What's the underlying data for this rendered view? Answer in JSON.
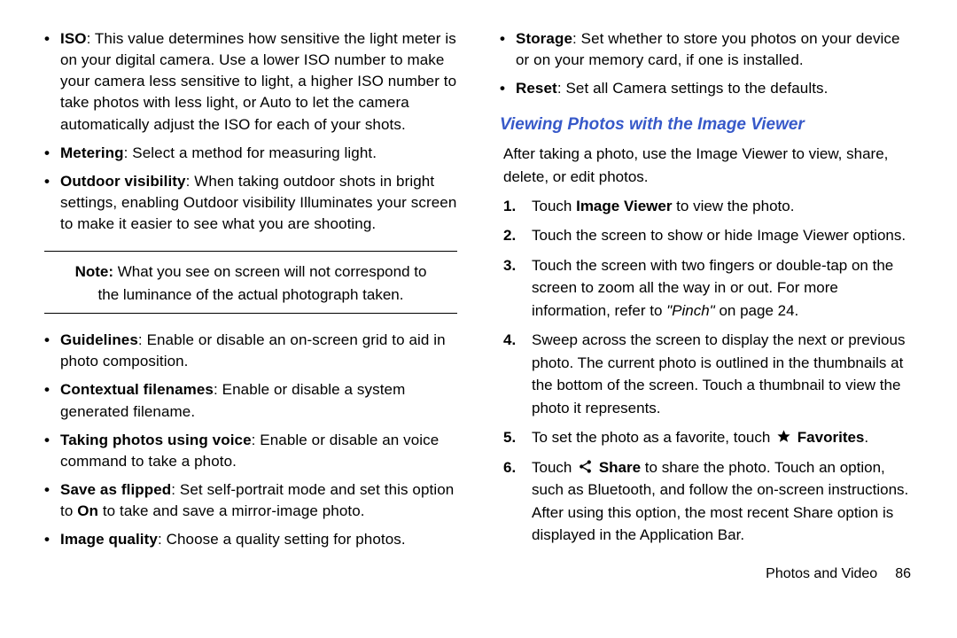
{
  "left": {
    "top_bullets": [
      {
        "term": "ISO",
        "text": ": This value determines how sensitive the light meter is on your digital camera. Use a lower ISO number to make your camera less sensitive to light, a higher ISO number to take photos with less light, or Auto to let the camera automatically adjust the ISO for each of your shots."
      },
      {
        "term": "Metering",
        "text": ": Select a method for measuring light."
      },
      {
        "term": "Outdoor visibility",
        "text": ": When taking outdoor shots in bright settings, enabling Outdoor visibility Illuminates your screen to make it easier to see what you are shooting."
      }
    ],
    "note_label": "Note:",
    "note_text": " What you see on screen will not correspond to the luminance of the actual photograph taken.",
    "mid_bullets": [
      {
        "term": "Guidelines",
        "text": ": Enable or disable an on-screen grid to aid in photo composition."
      },
      {
        "term": "Contextual filenames",
        "text": ": Enable or disable a system generated filename."
      },
      {
        "term": "Taking photos using voice",
        "text": ": Enable or disable an voice command to take a photo."
      },
      {
        "term": "Save as flipped",
        "pre": ": Set self-portrait mode and set this option to ",
        "bold2": "On",
        "post": " to take and save a mirror-image photo."
      },
      {
        "term": "Image quality",
        "text": ": Choose a quality setting for photos."
      }
    ]
  },
  "right": {
    "top_bullets": [
      {
        "term": "Storage",
        "text": ": Set whether to store you photos on your device or on your memory card, if one is installed."
      },
      {
        "term": "Reset",
        "text": ": Set all Camera settings to the defaults."
      }
    ],
    "heading": "Viewing Photos with the Image Viewer",
    "intro": "After taking a photo, use the Image Viewer to view, share, delete, or edit photos.",
    "steps": {
      "s1_pre": "Touch ",
      "s1_bold": "Image Viewer",
      "s1_post": " to view the photo.",
      "s2": "Touch the screen to show or hide Image Viewer options.",
      "s3_pre": "Touch the screen with two fingers or double-tap on the screen to zoom all the way in or out. For more information, refer to ",
      "s3_ital": "\"Pinch\"",
      "s3_post": " on page 24.",
      "s4": "Sweep across the screen to display the next or previous photo. The current photo is outlined in the thumbnails at the bottom of the screen. Touch a thumbnail to view the photo it represents.",
      "s5_pre": "To set the photo as a favorite, touch ",
      "s5_bold": "Favorites",
      "s5_post": ".",
      "s6_pre": "Touch ",
      "s6_bold": "Share",
      "s6_post": " to share the photo. Touch an option, such as Bluetooth, and follow the on-screen instructions. After using this option, the most recent Share option is displayed in the Application Bar."
    }
  },
  "footer": {
    "section": "Photos and Video",
    "page": "86"
  }
}
